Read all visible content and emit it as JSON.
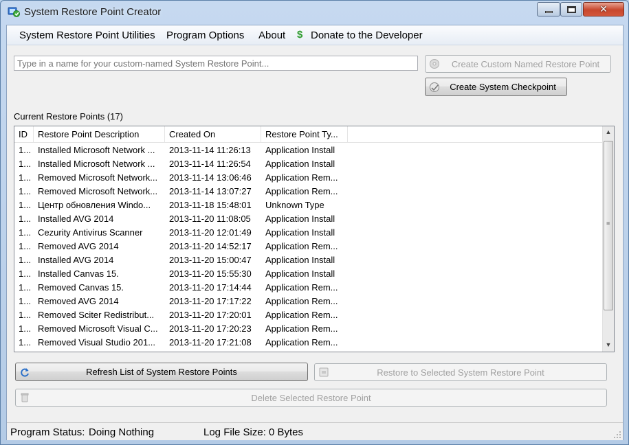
{
  "window": {
    "title": "System Restore Point Creator",
    "close_glyph": "✕"
  },
  "menu": {
    "utilities": "System Restore Point Utilities",
    "options": "Program Options",
    "about": "About",
    "donate": "Donate to the Developer",
    "donate_icon": "$"
  },
  "create": {
    "name_placeholder": "Type in a name for your custom-named System Restore Point...",
    "custom_button": "Create Custom Named Restore Point",
    "checkpoint_button": "Create System Checkpoint"
  },
  "restore_points": {
    "label": "Current Restore Points (17)",
    "columns": [
      "ID",
      "Restore Point Description",
      "Created On",
      "Restore Point Ty..."
    ],
    "rows": [
      {
        "id": "1...",
        "desc": "Installed Microsoft Network ...",
        "date": "2013-11-14 11:26:13",
        "type": "Application Install"
      },
      {
        "id": "1...",
        "desc": "Installed Microsoft Network ...",
        "date": "2013-11-14 11:26:54",
        "type": "Application Install"
      },
      {
        "id": "1...",
        "desc": "Removed Microsoft Network...",
        "date": "2013-11-14 13:06:46",
        "type": "Application Rem..."
      },
      {
        "id": "1...",
        "desc": "Removed Microsoft Network...",
        "date": "2013-11-14 13:07:27",
        "type": "Application Rem..."
      },
      {
        "id": "1...",
        "desc": "Центр обновления Windo...",
        "date": "2013-11-18 15:48:01",
        "type": "Unknown Type"
      },
      {
        "id": "1...",
        "desc": "Installed AVG 2014",
        "date": "2013-11-20 11:08:05",
        "type": "Application Install"
      },
      {
        "id": "1...",
        "desc": "Cezurity Antivirus Scanner",
        "date": "2013-11-20 12:01:49",
        "type": "Application Install"
      },
      {
        "id": "1...",
        "desc": "Removed AVG 2014",
        "date": "2013-11-20 14:52:17",
        "type": "Application Rem..."
      },
      {
        "id": "1...",
        "desc": "Installed AVG 2014",
        "date": "2013-11-20 15:00:47",
        "type": "Application Install"
      },
      {
        "id": "1...",
        "desc": "Installed Canvas 15.",
        "date": "2013-11-20 15:55:30",
        "type": "Application Install"
      },
      {
        "id": "1...",
        "desc": "Removed Canvas 15.",
        "date": "2013-11-20 17:14:44",
        "type": "Application Rem..."
      },
      {
        "id": "1...",
        "desc": "Removed AVG 2014",
        "date": "2013-11-20 17:17:22",
        "type": "Application Rem..."
      },
      {
        "id": "1...",
        "desc": "Removed Sciter Redistribut...",
        "date": "2013-11-20 17:20:01",
        "type": "Application Rem..."
      },
      {
        "id": "1...",
        "desc": "Removed Microsoft Visual C...",
        "date": "2013-11-20 17:20:23",
        "type": "Application Rem..."
      },
      {
        "id": "1...",
        "desc": "Removed Visual Studio 201...",
        "date": "2013-11-20 17:21:08",
        "type": "Application Rem..."
      }
    ]
  },
  "actions": {
    "refresh": "Refresh List of System Restore Points",
    "restore": "Restore to Selected System Restore Point",
    "delete": "Delete Selected Restore Point"
  },
  "status": {
    "program_status_label": "Program Status:",
    "program_status_value": "Doing Nothing",
    "log_size_label": "Log File Size:",
    "log_size_value": "0 Bytes"
  }
}
